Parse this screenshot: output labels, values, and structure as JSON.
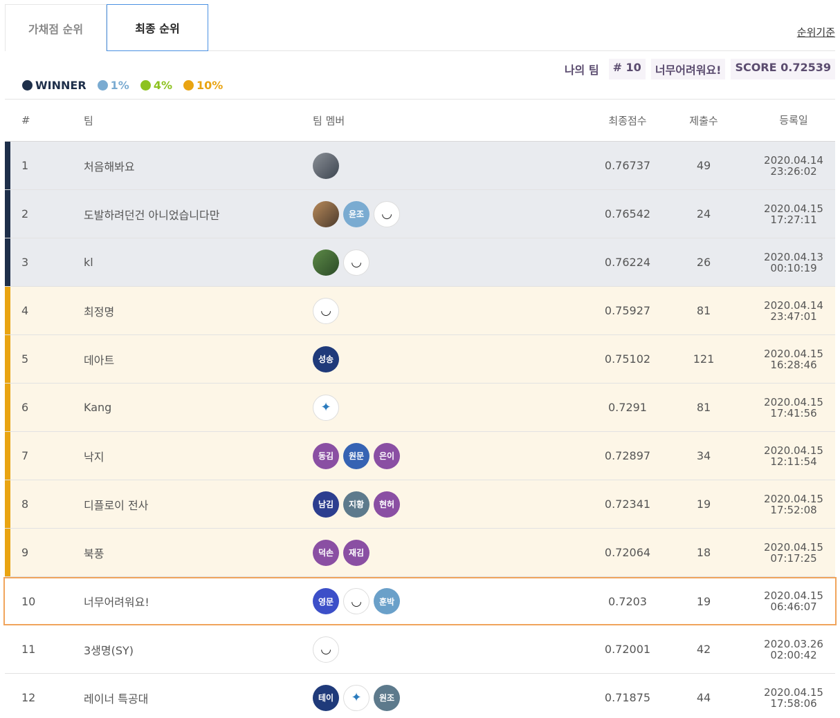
{
  "tabs": [
    {
      "label": "가채점 순위",
      "active": false
    },
    {
      "label": "최종 순위",
      "active": true
    }
  ],
  "criteria_link": "순위기준",
  "my_team": {
    "label": "나의 팀",
    "rank": "# 10",
    "name": "너무어려워요!",
    "score": "SCORE 0.72539"
  },
  "legend": [
    {
      "label": "WINNER",
      "color": "#1e2f4a"
    },
    {
      "label": "1%",
      "color": "#7aabd1"
    },
    {
      "label": "4%",
      "color": "#8dc21f"
    },
    {
      "label": "10%",
      "color": "#e9a412"
    }
  ],
  "headers": {
    "rank": "#",
    "team": "팀",
    "members": "팀 멤버",
    "score": "최종점수",
    "submissions": "제출수",
    "date": "등록일"
  },
  "rows": [
    {
      "rank": "1",
      "team": "처음해봐요",
      "score": "0.76737",
      "submissions": "49",
      "date": "2020.04.14",
      "time": "23:26:02",
      "tier": "winner",
      "members": [
        {
          "type": "photo",
          "label": ""
        }
      ]
    },
    {
      "rank": "2",
      "team": "도발하려던건 아니었습니다만",
      "score": "0.76542",
      "submissions": "24",
      "date": "2020.04.15",
      "time": "17:27:11",
      "tier": "winner",
      "members": [
        {
          "type": "photo",
          "label": ""
        },
        {
          "type": "text",
          "label": "윤조",
          "color": "#7aabd1"
        },
        {
          "type": "photo",
          "label": ""
        }
      ]
    },
    {
      "rank": "3",
      "team": "kl",
      "score": "0.76224",
      "submissions": "26",
      "date": "2020.04.13",
      "time": "00:10:19",
      "tier": "winner",
      "members": [
        {
          "type": "photo",
          "label": ""
        },
        {
          "type": "photo",
          "label": ""
        }
      ]
    },
    {
      "rank": "4",
      "team": "최정명",
      "score": "0.75927",
      "submissions": "81",
      "date": "2020.04.14",
      "time": "23:47:01",
      "tier": "ten",
      "members": [
        {
          "type": "photo",
          "label": ""
        }
      ]
    },
    {
      "rank": "5",
      "team": "데아트",
      "score": "0.75102",
      "submissions": "121",
      "date": "2020.04.15",
      "time": "16:28:46",
      "tier": "ten",
      "members": [
        {
          "type": "text",
          "label": "성송",
          "color": "#1f3a7a"
        }
      ]
    },
    {
      "rank": "6",
      "team": "Kang",
      "score": "0.7291",
      "submissions": "81",
      "date": "2020.04.15",
      "time": "17:41:56",
      "tier": "ten",
      "members": [
        {
          "type": "photo",
          "label": ""
        }
      ]
    },
    {
      "rank": "7",
      "team": "낙지",
      "score": "0.72897",
      "submissions": "34",
      "date": "2020.04.15",
      "time": "12:11:54",
      "tier": "ten",
      "members": [
        {
          "type": "text",
          "label": "동김",
          "color": "#8a4fa3"
        },
        {
          "type": "text",
          "label": "원문",
          "color": "#3663b3"
        },
        {
          "type": "text",
          "label": "은이",
          "color": "#8a4fa3"
        }
      ]
    },
    {
      "rank": "8",
      "team": "디플로이 전사",
      "score": "0.72341",
      "submissions": "19",
      "date": "2020.04.15",
      "time": "17:52:08",
      "tier": "ten",
      "members": [
        {
          "type": "text",
          "label": "남김",
          "color": "#2c3e8f"
        },
        {
          "type": "text",
          "label": "지황",
          "color": "#5d7a8c"
        },
        {
          "type": "text",
          "label": "현허",
          "color": "#8a4fa3"
        }
      ]
    },
    {
      "rank": "9",
      "team": "북풍",
      "score": "0.72064",
      "submissions": "18",
      "date": "2020.04.15",
      "time": "07:17:25",
      "tier": "ten",
      "members": [
        {
          "type": "text",
          "label": "덕손",
          "color": "#8a4fa3"
        },
        {
          "type": "text",
          "label": "재김",
          "color": "#8a4fa3"
        }
      ]
    },
    {
      "rank": "10",
      "team": "너무어려워요!",
      "score": "0.7203",
      "submissions": "19",
      "date": "2020.04.15",
      "time": "06:46:07",
      "tier": "mine",
      "members": [
        {
          "type": "text",
          "label": "영문",
          "color": "#3c4fc8"
        },
        {
          "type": "photo",
          "label": ""
        },
        {
          "type": "text",
          "label": "훈박",
          "color": "#6aa0c9"
        }
      ]
    },
    {
      "rank": "11",
      "team": "3생명(SY)",
      "score": "0.72001",
      "submissions": "42",
      "date": "2020.03.26",
      "time": "02:00:42",
      "tier": "none",
      "members": [
        {
          "type": "photo",
          "label": ""
        }
      ]
    },
    {
      "rank": "12",
      "team": "레이너 특공대",
      "score": "0.71875",
      "submissions": "44",
      "date": "2020.04.15",
      "time": "17:58:06",
      "tier": "none",
      "members": [
        {
          "type": "text",
          "label": "테이",
          "color": "#1f3a7a"
        },
        {
          "type": "photo",
          "label": ""
        },
        {
          "type": "text",
          "label": "원조",
          "color": "#5d7a8c"
        }
      ]
    }
  ]
}
